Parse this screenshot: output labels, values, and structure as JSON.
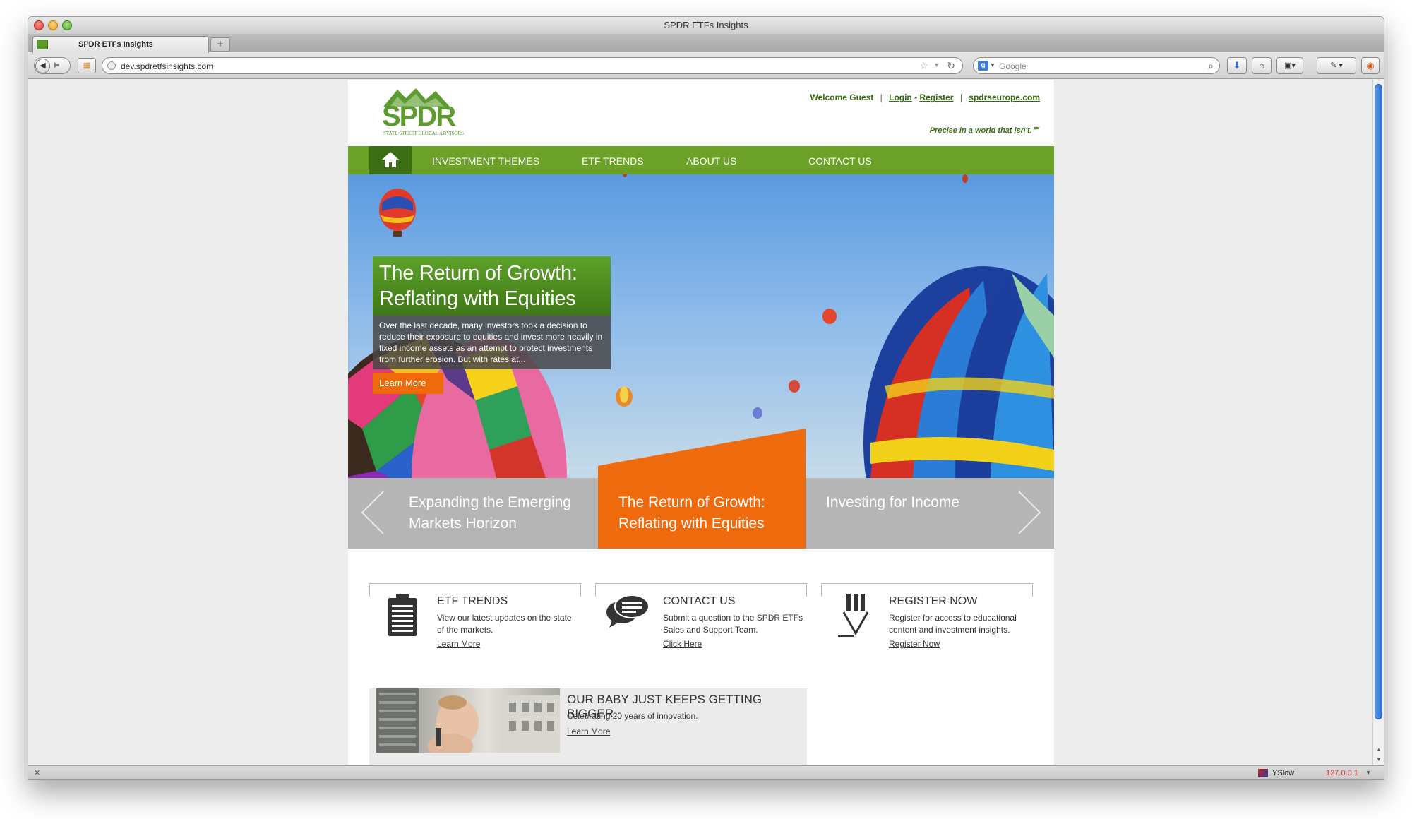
{
  "window": {
    "title": "SPDR ETFs Insights",
    "tab_label": "SPDR ETFs Insights",
    "new_tab": "+"
  },
  "toolbar": {
    "url": "dev.spdretfsinsights.com",
    "search_placeholder": "Google"
  },
  "statusbar": {
    "yslow": "YSlow",
    "ip": "127.0.0.1"
  },
  "header": {
    "logo_text": "SPDR",
    "logo_sub": "STATE STREET GLOBAL ADVISORS",
    "welcome": "Welcome Guest",
    "login": "Login",
    "register": "Register",
    "site_link": "spdrseurope.com",
    "tagline": "Precise in a world that isn't.℠"
  },
  "nav": {
    "items": [
      {
        "label": "INVESTMENT THEMES"
      },
      {
        "label": "ETF TRENDS"
      },
      {
        "label": "ABOUT US"
      },
      {
        "label": "CONTACT US"
      }
    ]
  },
  "hero": {
    "title_line1": "The Return of Growth:",
    "title_line2": "Reflating with Equities",
    "description": "Over the last decade, many investors took a decision to reduce their exposure to equities and invest more heavily in fixed income assets as an attempt to protect investments from further erosion. But with rates at...",
    "button": "Learn More"
  },
  "carousel": {
    "items": [
      {
        "line1": "Expanding the Emerging",
        "line2": "Markets Horizon"
      },
      {
        "line1": "The Return of Growth:",
        "line2": "Reflating with Equities"
      },
      {
        "line1": "Investing for Income",
        "line2": ""
      }
    ]
  },
  "features": [
    {
      "icon": "clipboard-icon",
      "title": "ETF TRENDS",
      "desc": "View our latest updates on the state of the markets.",
      "link": "Learn More"
    },
    {
      "icon": "speech-bubbles-icon",
      "title": "CONTACT US",
      "desc": "Submit a question to the SPDR ETFs Sales and Support Team.",
      "link": "Click Here"
    },
    {
      "icon": "pencil-icon",
      "title": "REGISTER NOW",
      "desc": "Register for access to educational content and investment insights.",
      "link": "Register Now"
    }
  ],
  "promo": {
    "title": "OUR BABY JUST KEEPS GETTING BIGGER",
    "subtitle": "Celebrating 20 years of innovation.",
    "link": "Learn More"
  },
  "colors": {
    "brand_green": "#6aa126",
    "dark_green": "#3c6f14",
    "orange": "#ef6a0d",
    "gray": "#b5b5b5"
  }
}
